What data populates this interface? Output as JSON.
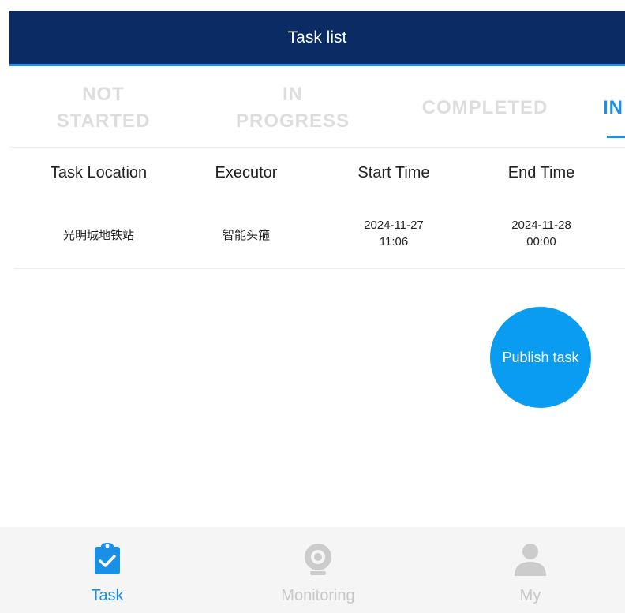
{
  "header": {
    "title": "Task list"
  },
  "tabs": [
    {
      "line1": "NOT",
      "line2": "STARTED"
    },
    {
      "line1": "IN",
      "line2": "PROGRESS"
    },
    {
      "line1": "COMPLETED",
      "line2": ""
    },
    {
      "line1": "IN",
      "line2": ""
    }
  ],
  "table": {
    "columns": [
      "Task Location",
      "Executor",
      "Start Time",
      "End Time"
    ],
    "rows": [
      {
        "location": "光明城地铁站",
        "executor": "智能头箍",
        "start_date": "2024-11-27",
        "start_time": "11:06",
        "end_date": "2024-11-28",
        "end_time": "00:00"
      }
    ]
  },
  "fab": {
    "label": "Publish task"
  },
  "nav": {
    "items": [
      {
        "label": "Task",
        "icon": "clipboard-check-icon",
        "active": true
      },
      {
        "label": "Monitoring",
        "icon": "webcam-icon",
        "active": false
      },
      {
        "label": "My",
        "icon": "user-icon",
        "active": false
      }
    ]
  },
  "colors": {
    "header_bg": "#0a2b63",
    "accent": "#1a8fe6",
    "fab_bg": "#0a9cf1",
    "inactive_tab": "#dddddd",
    "nav_inactive": "#cccccc"
  }
}
